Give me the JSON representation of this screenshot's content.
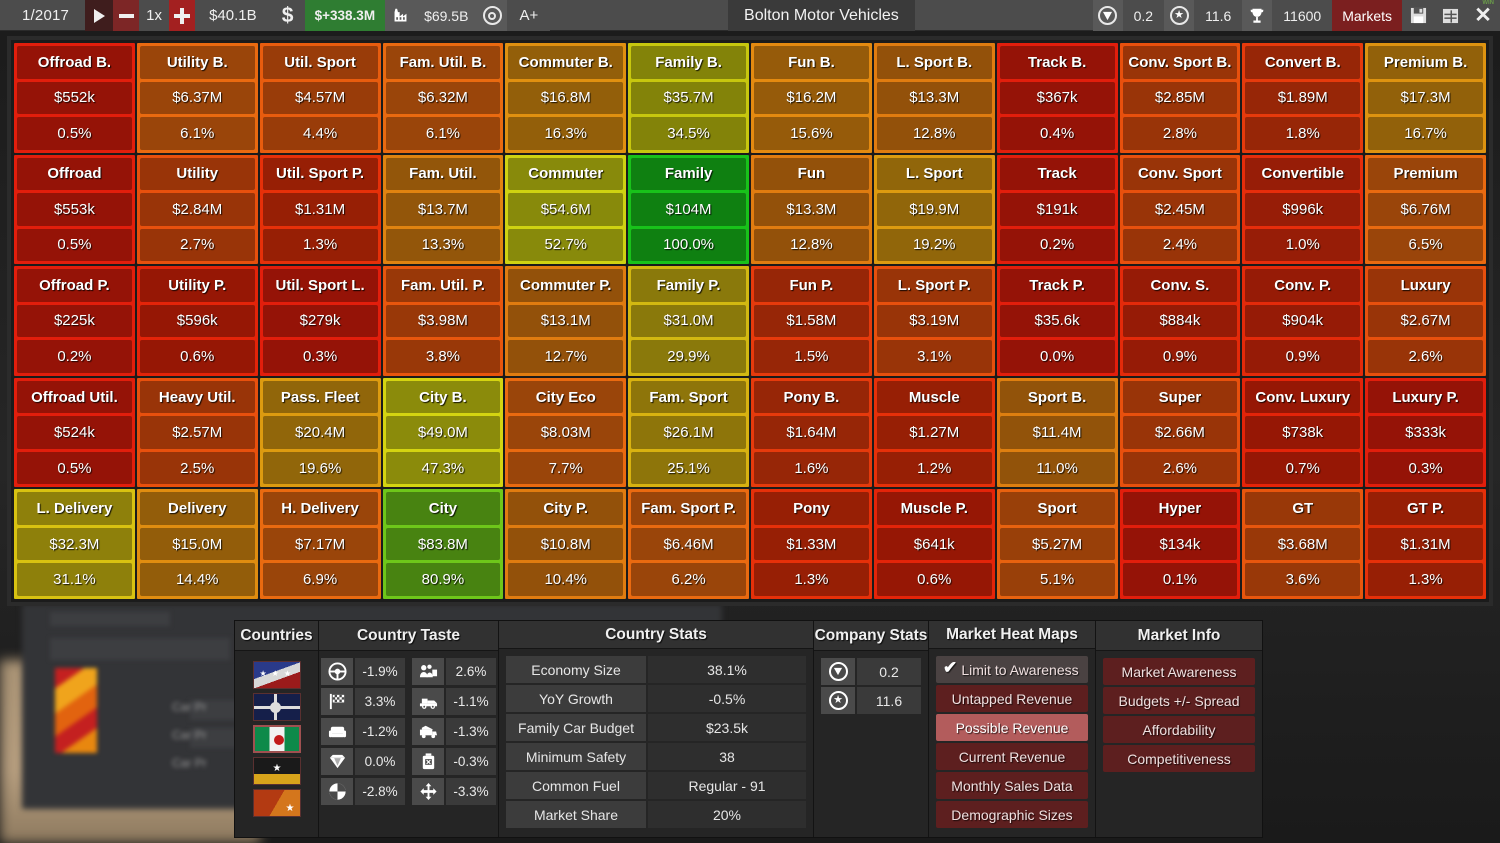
{
  "topbar": {
    "date": "1/2017",
    "play_icon": "play-icon",
    "minus_icon": "minus-icon",
    "speed": "1x",
    "plus_icon": "plus-icon",
    "cash": "$40.1B",
    "dollar_icon": "dollar-icon",
    "profit": "$+338.3M",
    "factory_icon": "factory-icon",
    "value": "$69.5B",
    "target_icon": "target-icon",
    "grade": "A+",
    "title": "Bolton Motor Vehicles",
    "gem_icon": "gem-icon",
    "gem_value": "0.2",
    "star_icon": "star-icon",
    "star_value": "11.6",
    "trophy_icon": "trophy-icon",
    "trophy_value": "11600",
    "markets_label": "Markets",
    "save_icon": "save-icon",
    "window-icon": "window-icon",
    "close_icon": "close-icon",
    "win_label": "WIN"
  },
  "grid": {
    "rows": [
      [
        {
          "name": "Offroad B.",
          "value": "$552k",
          "pct": "0.5%",
          "color": "#e21e0c"
        },
        {
          "name": "Utility B.",
          "value": "$6.37M",
          "pct": "6.1%",
          "color": "#ea6a10"
        },
        {
          "name": "Util. Sport",
          "value": "$4.57M",
          "pct": "4.4%",
          "color": "#e85c0e"
        },
        {
          "name": "Fam. Util. B.",
          "value": "$6.32M",
          "pct": "6.1%",
          "color": "#ea6a10"
        },
        {
          "name": "Commuter B.",
          "value": "$16.8M",
          "pct": "16.3%",
          "color": "#e09010"
        },
        {
          "name": "Family B.",
          "value": "$35.7M",
          "pct": "34.5%",
          "color": "#c7c70e"
        },
        {
          "name": "Fun B.",
          "value": "$16.2M",
          "pct": "15.6%",
          "color": "#e48a10"
        },
        {
          "name": "L. Sport B.",
          "value": "$13.3M",
          "pct": "12.8%",
          "color": "#e07c10"
        },
        {
          "name": "Track B.",
          "value": "$367k",
          "pct": "0.4%",
          "color": "#e21e0c"
        },
        {
          "name": "Conv. Sport B.",
          "value": "$2.85M",
          "pct": "2.8%",
          "color": "#e8500d"
        },
        {
          "name": "Convert B.",
          "value": "$1.89M",
          "pct": "1.8%",
          "color": "#e63a0c"
        },
        {
          "name": "Premium B.",
          "value": "$17.3M",
          "pct": "16.7%",
          "color": "#de9310"
        }
      ],
      [
        {
          "name": "Offroad",
          "value": "$553k",
          "pct": "0.5%",
          "color": "#e21e0c"
        },
        {
          "name": "Utility",
          "value": "$2.84M",
          "pct": "2.7%",
          "color": "#e8500d"
        },
        {
          "name": "Util. Sport P.",
          "value": "$1.31M",
          "pct": "1.3%",
          "color": "#e63009"
        },
        {
          "name": "Fam. Util.",
          "value": "$13.7M",
          "pct": "13.3%",
          "color": "#e08310"
        },
        {
          "name": "Commuter",
          "value": "$54.6M",
          "pct": "52.7%",
          "color": "#cfd211"
        },
        {
          "name": "Family",
          "value": "$104M",
          "pct": "100.0%",
          "color": "#18c21a"
        },
        {
          "name": "Fun",
          "value": "$13.3M",
          "pct": "12.8%",
          "color": "#e07c10"
        },
        {
          "name": "L. Sport",
          "value": "$19.9M",
          "pct": "19.2%",
          "color": "#dd9b10"
        },
        {
          "name": "Track",
          "value": "$191k",
          "pct": "0.2%",
          "color": "#e21e0c"
        },
        {
          "name": "Conv. Sport",
          "value": "$2.45M",
          "pct": "2.4%",
          "color": "#e8500d"
        },
        {
          "name": "Convertible",
          "value": "$996k",
          "pct": "1.0%",
          "color": "#e62d0b"
        },
        {
          "name": "Premium",
          "value": "$6.76M",
          "pct": "6.5%",
          "color": "#ea6a10"
        }
      ],
      [
        {
          "name": "Offroad P.",
          "value": "$225k",
          "pct": "0.2%",
          "color": "#e21e0c"
        },
        {
          "name": "Utility P.",
          "value": "$596k",
          "pct": "0.6%",
          "color": "#e42409"
        },
        {
          "name": "Util. Sport L.",
          "value": "$279k",
          "pct": "0.3%",
          "color": "#e21e0c"
        },
        {
          "name": "Fam. Util. P.",
          "value": "$3.98M",
          "pct": "3.8%",
          "color": "#e8560d"
        },
        {
          "name": "Commuter P.",
          "value": "$13.1M",
          "pct": "12.7%",
          "color": "#e07c10"
        },
        {
          "name": "Family P.",
          "value": "$31.0M",
          "pct": "29.9%",
          "color": "#d2b811"
        },
        {
          "name": "Fun P.",
          "value": "$1.58M",
          "pct": "1.5%",
          "color": "#e63a0c"
        },
        {
          "name": "L. Sport P.",
          "value": "$3.19M",
          "pct": "3.1%",
          "color": "#e8500d"
        },
        {
          "name": "Track P.",
          "value": "$35.6k",
          "pct": "0.0%",
          "color": "#e21e0c"
        },
        {
          "name": "Conv. S.",
          "value": "$884k",
          "pct": "0.9%",
          "color": "#e42a0a"
        },
        {
          "name": "Conv. P.",
          "value": "$904k",
          "pct": "0.9%",
          "color": "#e42a0a"
        },
        {
          "name": "Luxury",
          "value": "$2.67M",
          "pct": "2.6%",
          "color": "#e8500d"
        }
      ],
      [
        {
          "name": "Offroad Util.",
          "value": "$524k",
          "pct": "0.5%",
          "color": "#e21e0c"
        },
        {
          "name": "Heavy Util.",
          "value": "$2.57M",
          "pct": "2.5%",
          "color": "#e8500d"
        },
        {
          "name": "Pass. Fleet",
          "value": "$20.4M",
          "pct": "19.6%",
          "color": "#dd9b10"
        },
        {
          "name": "City B.",
          "value": "$49.0M",
          "pct": "47.3%",
          "color": "#d4d411"
        },
        {
          "name": "City Eco",
          "value": "$8.03M",
          "pct": "7.7%",
          "color": "#ea6a10"
        },
        {
          "name": "Fam. Sport",
          "value": "$26.1M",
          "pct": "25.1%",
          "color": "#d8b210"
        },
        {
          "name": "Pony B.",
          "value": "$1.64M",
          "pct": "1.6%",
          "color": "#e63a0c"
        },
        {
          "name": "Muscle",
          "value": "$1.27M",
          "pct": "1.2%",
          "color": "#e63009"
        },
        {
          "name": "Sport B.",
          "value": "$11.4M",
          "pct": "11.0%",
          "color": "#de7f10"
        },
        {
          "name": "Super",
          "value": "$2.66M",
          "pct": "2.6%",
          "color": "#e8500d"
        },
        {
          "name": "Conv. Luxury",
          "value": "$738k",
          "pct": "0.7%",
          "color": "#e42409"
        },
        {
          "name": "Luxury P.",
          "value": "$333k",
          "pct": "0.3%",
          "color": "#e21e0c"
        }
      ],
      [
        {
          "name": "L. Delivery",
          "value": "$32.3M",
          "pct": "31.1%",
          "color": "#d8c211"
        },
        {
          "name": "Delivery",
          "value": "$15.0M",
          "pct": "14.4%",
          "color": "#e08d10"
        },
        {
          "name": "H. Delivery",
          "value": "$7.17M",
          "pct": "6.9%",
          "color": "#ea6a10"
        },
        {
          "name": "City",
          "value": "$83.8M",
          "pct": "80.9%",
          "color": "#6ec71a"
        },
        {
          "name": "City P.",
          "value": "$10.8M",
          "pct": "10.4%",
          "color": "#e07c10"
        },
        {
          "name": "Fam. Sport P.",
          "value": "$6.46M",
          "pct": "6.2%",
          "color": "#ea6a10"
        },
        {
          "name": "Pony",
          "value": "$1.33M",
          "pct": "1.3%",
          "color": "#e63009"
        },
        {
          "name": "Muscle P.",
          "value": "$641k",
          "pct": "0.6%",
          "color": "#e42409"
        },
        {
          "name": "Sport",
          "value": "$5.27M",
          "pct": "5.1%",
          "color": "#e8620f"
        },
        {
          "name": "Hyper",
          "value": "$134k",
          "pct": "0.1%",
          "color": "#e21e0c"
        },
        {
          "name": "GT",
          "value": "$3.68M",
          "pct": "3.6%",
          "color": "#e8560d"
        },
        {
          "name": "GT P.",
          "value": "$1.31M",
          "pct": "1.3%",
          "color": "#e63009"
        }
      ]
    ]
  },
  "dock": {
    "countries": {
      "title": "Countries",
      "flags": [
        {
          "name": "flag-1",
          "selected": false
        },
        {
          "name": "flag-2",
          "selected": false
        },
        {
          "name": "flag-3",
          "selected": true
        },
        {
          "name": "flag-4",
          "selected": false
        },
        {
          "name": "flag-5",
          "selected": false
        }
      ]
    },
    "country_taste": {
      "title": "Country Taste",
      "left": [
        {
          "icon": "steering-wheel-icon",
          "value": "-1.9%"
        },
        {
          "icon": "checkered-flag-icon",
          "value": "3.3%"
        },
        {
          "icon": "armchair-icon",
          "value": "-1.2%"
        },
        {
          "icon": "gem-icon",
          "value": "0.0%"
        },
        {
          "icon": "pie-chart-icon",
          "value": "-2.8%"
        }
      ],
      "right": [
        {
          "icon": "people-icon",
          "value": "2.6%"
        },
        {
          "icon": "pickup-truck-icon",
          "value": "-1.1%"
        },
        {
          "icon": "cargo-icon",
          "value": "-1.3%"
        },
        {
          "icon": "fuel-can-icon",
          "value": "-0.3%"
        },
        {
          "icon": "move-arrows-icon",
          "value": "-3.3%"
        }
      ]
    },
    "country_stats": {
      "title": "Country Stats",
      "rows": [
        {
          "label": "Economy Size",
          "value": "38.1%"
        },
        {
          "label": "YoY Growth",
          "value": "-0.5%"
        },
        {
          "label": "Family Car Budget",
          "value": "$23.5k"
        },
        {
          "label": "Minimum Safety",
          "value": "38"
        },
        {
          "label": "Common Fuel",
          "value": "Regular - 91"
        },
        {
          "label": "Market Share",
          "value": "20%"
        }
      ]
    },
    "company_stats": {
      "title": "Company Stats",
      "rows": [
        {
          "icon": "gem-icon",
          "value": "0.2"
        },
        {
          "icon": "star-icon",
          "value": "11.6"
        }
      ]
    },
    "heat_maps": {
      "title": "Market Heat Maps",
      "buttons": [
        {
          "label": "Limit to Awareness",
          "state": "checked"
        },
        {
          "label": "Untapped Revenue",
          "state": "normal"
        },
        {
          "label": "Possible Revenue",
          "state": "active"
        },
        {
          "label": "Current Revenue",
          "state": "normal"
        },
        {
          "label": "Monthly Sales Data",
          "state": "normal"
        },
        {
          "label": "Demographic Sizes",
          "state": "normal"
        }
      ],
      "check_glyph": "✔"
    },
    "market_info": {
      "title": "Market Info",
      "buttons": [
        {
          "label": "Market Awareness"
        },
        {
          "label": "Budgets +/- Spread"
        },
        {
          "label": "Affordability"
        },
        {
          "label": "Competitiveness"
        }
      ]
    }
  }
}
